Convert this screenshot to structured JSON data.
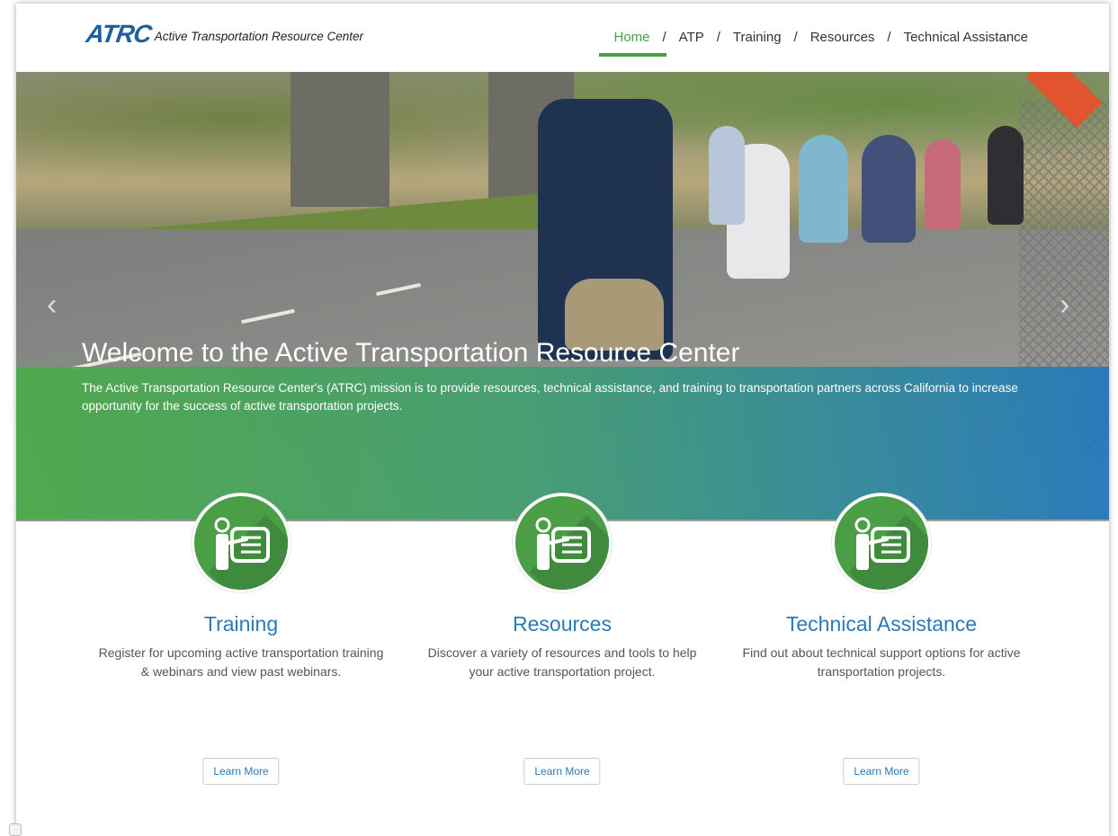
{
  "logo": {
    "mark": "ATRC",
    "text": "Active Transportation Resource Center"
  },
  "nav": {
    "items": [
      {
        "label": "Home",
        "active": true
      },
      {
        "label": "ATP",
        "active": false
      },
      {
        "label": "Training",
        "active": false
      },
      {
        "label": "Resources",
        "active": false
      },
      {
        "label": "Technical Assistance",
        "active": false
      }
    ],
    "separator": "/"
  },
  "hero": {
    "title": "Welcome to the Active Transportation Resource Center",
    "description": "The Active Transportation Resource Center's (ATRC) mission is to provide resources, technical assistance, and training to transportation partners across California to increase opportunity for the success of active transportation projects.",
    "prev_arrow": "‹",
    "next_arrow": "›"
  },
  "features": [
    {
      "title": "Training",
      "description": "Register for upcoming active transportation training & webinars and view past webinars.",
      "button": "Learn More",
      "icon": "presenter-board-icon"
    },
    {
      "title": "Resources",
      "description": "Discover a variety of resources and tools to help your active transportation project.",
      "button": "Learn More",
      "icon": "presenter-board-icon"
    },
    {
      "title": "Technical Assistance",
      "description": "Find out about technical support options for active transportation projects.",
      "button": "Learn More",
      "icon": "presenter-board-icon"
    }
  ],
  "colors": {
    "green": "#4a9e46",
    "blue": "#2a7ab8",
    "band_start": "#4caa48",
    "band_end": "#2278be"
  }
}
